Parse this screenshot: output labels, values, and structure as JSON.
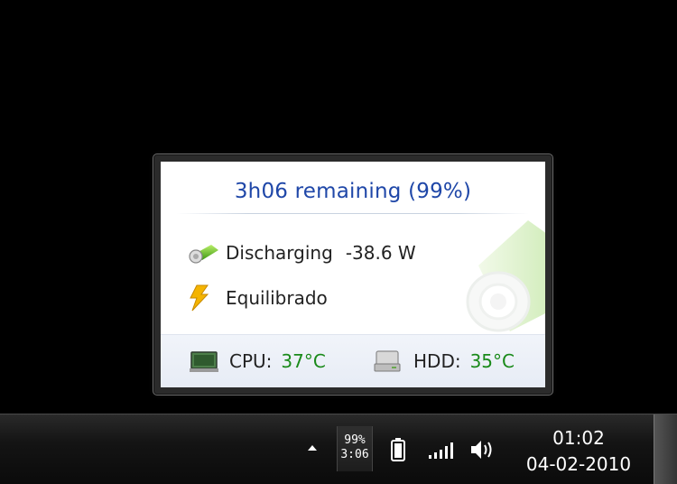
{
  "popup": {
    "title": "3h06 remaining (99%)",
    "status_label": "Discharging",
    "power_value": "-38.6 W",
    "power_plan": "Equilibrado",
    "footer": {
      "cpu_label": "CPU:",
      "cpu_temp": "37°C",
      "hdd_label": "HDD:",
      "hdd_temp": "35°C"
    },
    "colors": {
      "title": "#1f47a8",
      "temp": "#1a8a1a"
    }
  },
  "taskbar": {
    "battery_percent": "99%",
    "battery_time": "3:06",
    "clock_time": "01:02",
    "clock_date": "04-02-2010",
    "icons": [
      "show-hidden-icons-arrow",
      "battery-icon",
      "signal-icon",
      "volume-icon"
    ]
  }
}
